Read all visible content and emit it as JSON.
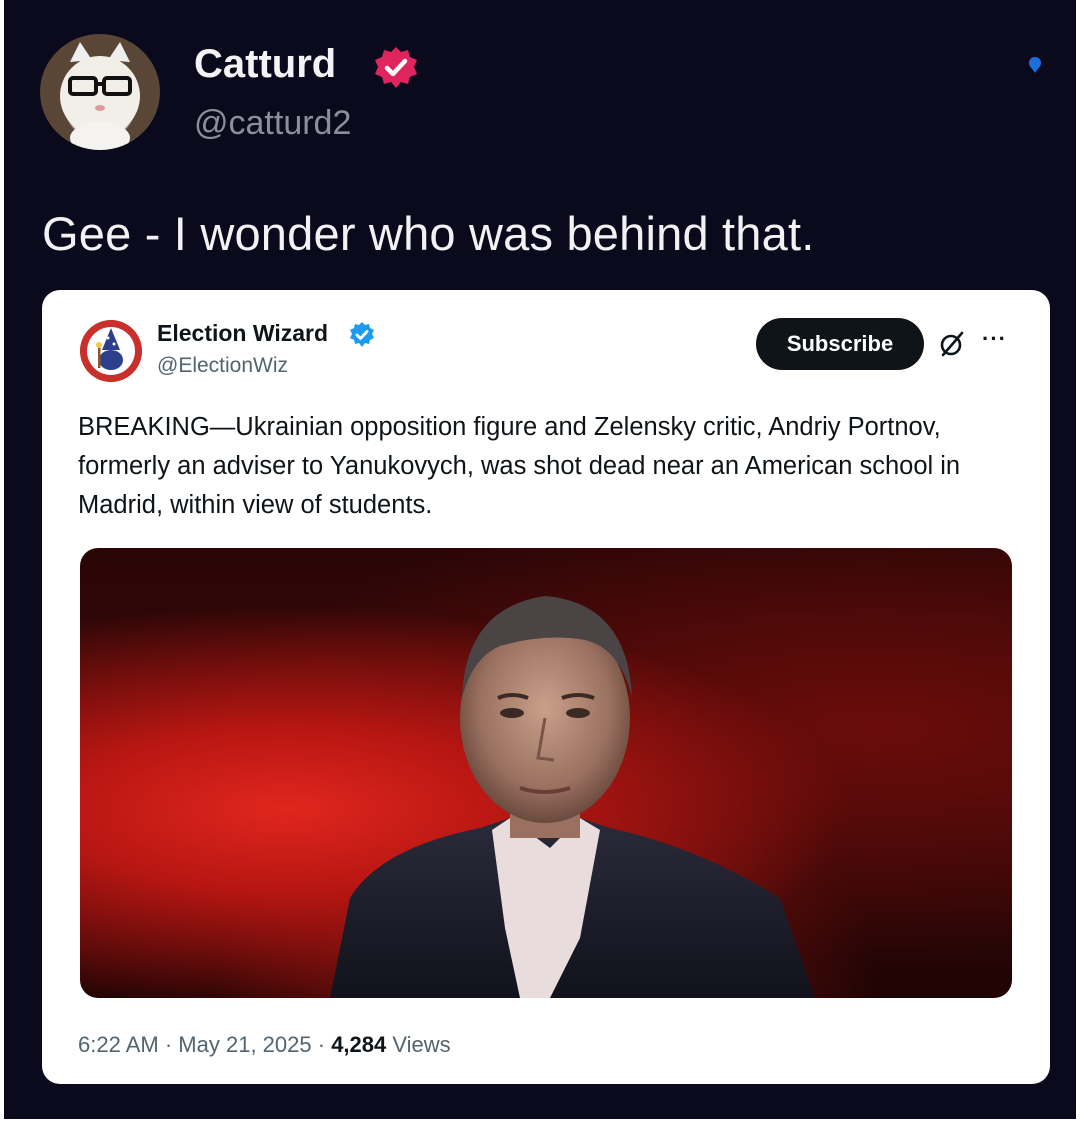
{
  "tweet": {
    "display_name": "Catturd",
    "handle": "@catturd2",
    "text": "Gee - I wonder who was behind that.",
    "verified_color": "#e0245e"
  },
  "quoted": {
    "display_name": "Election Wizard",
    "handle": "@ElectionWiz",
    "subscribe_label": "Subscribe",
    "more_label": "···",
    "text": "BREAKING—Ukrainian opposition figure and Zelensky critic, Andriy Portnov, formerly an adviser to Yanukovych, was shot dead near an American school in Madrid, within view of students.",
    "time": "6:22 AM",
    "date": "May 21, 2025",
    "separator": "·",
    "views_count": "4,284",
    "views_label": "Views",
    "verified_color": "#1d9bf0"
  },
  "icons": [
    "verified-badge-icon",
    "grok-icon",
    "more-icon"
  ]
}
